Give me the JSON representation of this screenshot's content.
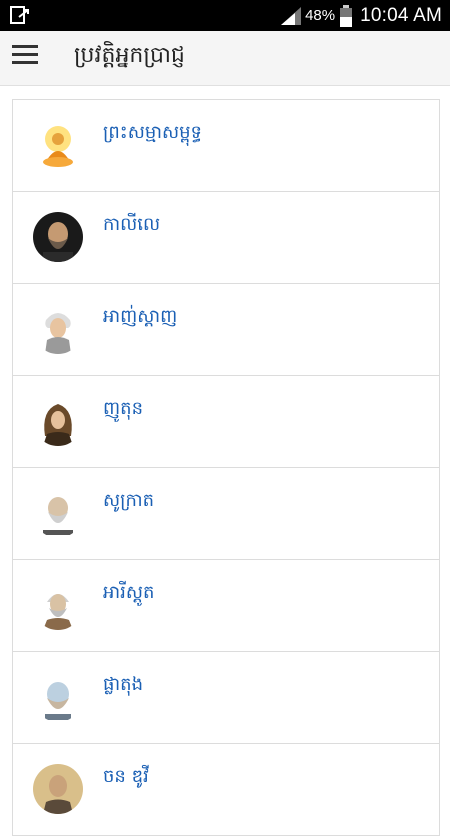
{
  "status_bar": {
    "battery_percent": "48%",
    "time": "10:04 AM"
  },
  "app_bar": {
    "title": "ប្រវត្តិអ្នកប្រាជ្ញ",
    "menu_icon": "hamburger-menu-icon"
  },
  "list": {
    "items": [
      {
        "label": "ព្រះសម្មាសម្ពុទ្ធ",
        "icon": "buddha-avatar"
      },
      {
        "label": "កាលីលេ",
        "icon": "galileo-avatar"
      },
      {
        "label": "អាញ់ស្តាញ",
        "icon": "einstein-avatar"
      },
      {
        "label": "ញូតុន",
        "icon": "newton-avatar"
      },
      {
        "label": "សូក្រាត",
        "icon": "socrates-avatar"
      },
      {
        "label": "អារីស្តូត",
        "icon": "aristotle-avatar"
      },
      {
        "label": "ផ្លាតុង",
        "icon": "plato-avatar"
      },
      {
        "label": "ចន ឌូវី",
        "icon": "dewey-avatar"
      }
    ]
  }
}
